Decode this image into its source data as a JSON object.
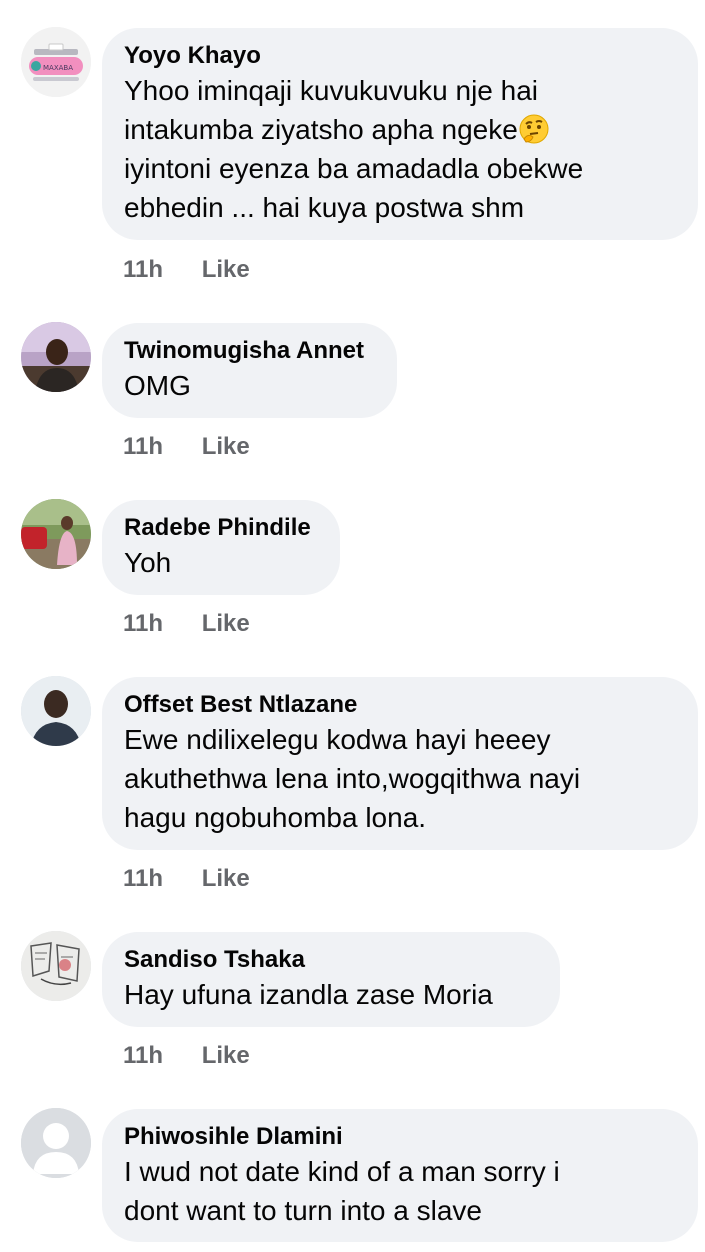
{
  "comments": [
    {
      "author": "Yoyo Khayo",
      "lines": [
        "Yhoo iminqaji kuvukuvuku nje hai",
        "intakumba ziyatsho apha ngeke",
        "iyintoni eyenza ba amadadla obekwe",
        "ebhedin ... hai kuya postwa shm"
      ],
      "time": "11h",
      "like": "Like",
      "avatar_icon": "pink-logo-avatar-icon",
      "avatar_text": "MAXABA",
      "emoji": "thinking-face-icon"
    },
    {
      "author": "Twinomugisha Annet",
      "lines": [
        "OMG"
      ],
      "time": "11h",
      "like": "Like",
      "avatar_icon": "person-photo-avatar-icon"
    },
    {
      "author": "Radebe Phindile",
      "lines": [
        "Yoh"
      ],
      "time": "11h",
      "like": "Like",
      "avatar_icon": "outdoor-photo-avatar-icon"
    },
    {
      "author": "Offset Best Ntlazane",
      "lines": [
        "Ewe ndilixelegu kodwa hayi heeey",
        "akuthethwa lena into,wogqithwa nayi",
        "hagu ngobuhomba lona."
      ],
      "time": "11h",
      "like": "Like",
      "avatar_icon": "person-photo-avatar-icon"
    },
    {
      "author": "Sandiso Tshaka",
      "lines": [
        "Hay ufuna izandla zase Moria"
      ],
      "time": "11h",
      "like": "Like",
      "avatar_icon": "sketch-avatar-icon"
    },
    {
      "author": "Phiwosihle Dlamini",
      "lines": [
        "I wud not date kind of a man sorry i",
        "dont want to turn into a slave"
      ],
      "avatar_icon": "default-profile-avatar-icon"
    }
  ],
  "colors": {
    "bubble": "#f0f2f5",
    "text": "#050505",
    "meta": "#65676b"
  }
}
